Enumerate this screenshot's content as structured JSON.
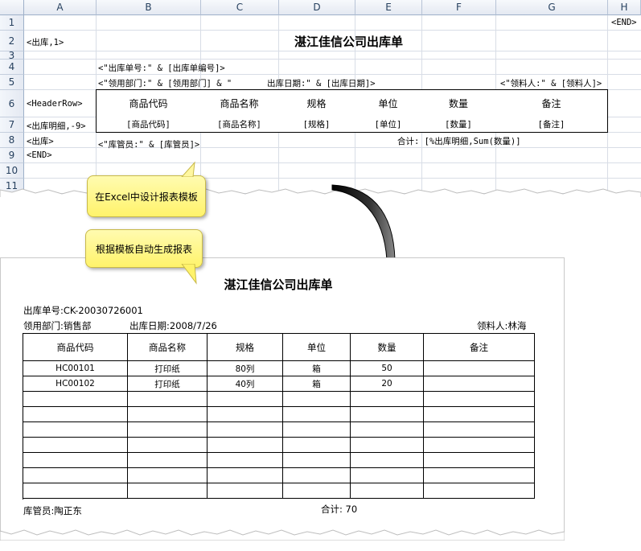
{
  "sheet": {
    "columns": [
      "A",
      "B",
      "C",
      "D",
      "E",
      "F",
      "G",
      "H"
    ],
    "rows": [
      "1",
      "2",
      "3",
      "4",
      "5",
      "6",
      "7",
      "8",
      "9",
      "10",
      "11"
    ],
    "h1_end": "<END>",
    "a2_tag": "<出库,1>",
    "title": "湛江佳信公司出库单",
    "b4_formula": "<\"出库单号:\" & [出库单编号]>",
    "b5_formula": "<\"领用部门:\" & [领用部门] & \"",
    "d5_formula": "出库日期:\" & [出库日期]>",
    "g5_formula": "<\"领料人:\" & [领料人]>",
    "a6_tag": "<HeaderRow>",
    "headers": [
      "商品代码",
      "商品名称",
      "规格",
      "单位",
      "数量",
      "备注"
    ],
    "a7_tag": "<出库明细,-9>",
    "fields": [
      "[商品代码]",
      "[商品名称]",
      "[规格]",
      "[单位]",
      "[数量]",
      "[备注]"
    ],
    "a8_tag": "<出库>",
    "b8_formula": "<\"库管员:\" & [库管员]>",
    "f8_formula": "合计: [%出库明细,Sum(数量)]",
    "a9_tag": "<END>"
  },
  "callouts": {
    "design": "在Excel中设计报表模板",
    "generate": "根据模板自动生成报表"
  },
  "report": {
    "title": "湛江佳信公司出库单",
    "order_no": "出库单号:CK-20030726001",
    "dept": "领用部门:销售部",
    "date": "出库日期:2008/7/26",
    "receiver": "领料人:林海",
    "headers": [
      "商品代码",
      "商品名称",
      "规格",
      "单位",
      "数量",
      "备注"
    ],
    "rows": [
      [
        "HC00101",
        "打印纸",
        "80列",
        "箱",
        "50",
        ""
      ],
      [
        "HC00102",
        "打印纸",
        "40列",
        "箱",
        "20",
        ""
      ],
      [
        "",
        "",
        "",
        "",
        "",
        ""
      ],
      [
        "",
        "",
        "",
        "",
        "",
        ""
      ],
      [
        "",
        "",
        "",
        "",
        "",
        ""
      ],
      [
        "",
        "",
        "",
        "",
        "",
        ""
      ],
      [
        "",
        "",
        "",
        "",
        "",
        ""
      ],
      [
        "",
        "",
        "",
        "",
        "",
        ""
      ],
      [
        "",
        "",
        "",
        "",
        "",
        ""
      ]
    ],
    "keeper": "库管员:陶正东",
    "total": "合计: 70"
  }
}
